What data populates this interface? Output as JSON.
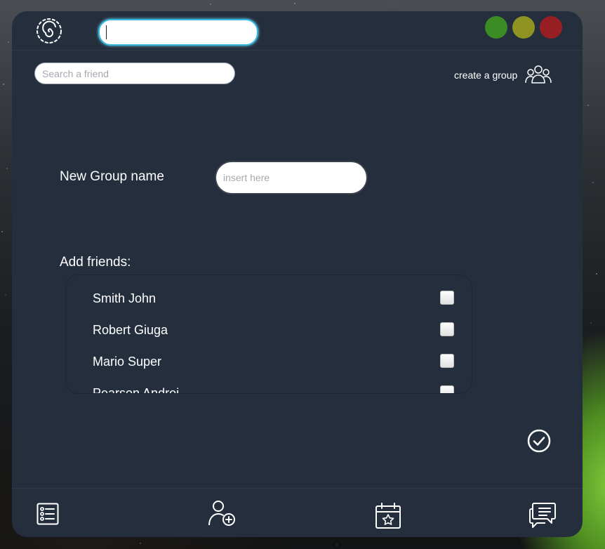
{
  "window": {
    "title_input_value": "",
    "controls": [
      {
        "name": "maximize",
        "color": "#3b8c24"
      },
      {
        "name": "minimize",
        "color": "#8f9321"
      },
      {
        "name": "close",
        "color": "#971f24"
      }
    ]
  },
  "header": {
    "search_placeholder": "Search a friend",
    "create_group_label": "create a group",
    "create_group_icon": "group-icon"
  },
  "form": {
    "group_name_label": "New Group name",
    "group_name_placeholder": "insert here",
    "add_friends_label": "Add friends:"
  },
  "friends": [
    {
      "name": "Smith John",
      "checked": false
    },
    {
      "name": "Robert Giuga",
      "checked": false
    },
    {
      "name": "Mario Super",
      "checked": false
    },
    {
      "name": "Pearson Andrei",
      "checked": false
    }
  ],
  "confirm_icon": "check-circle-icon",
  "bottom_nav": [
    {
      "id": "list",
      "icon": "list-icon"
    },
    {
      "id": "add-friend",
      "icon": "add-user-icon"
    },
    {
      "id": "events",
      "icon": "calendar-star-icon"
    },
    {
      "id": "chat",
      "icon": "chat-icon"
    }
  ],
  "colors": {
    "panel": "#242e3d",
    "accent": "#35b8e0",
    "text": "#ffffff"
  }
}
